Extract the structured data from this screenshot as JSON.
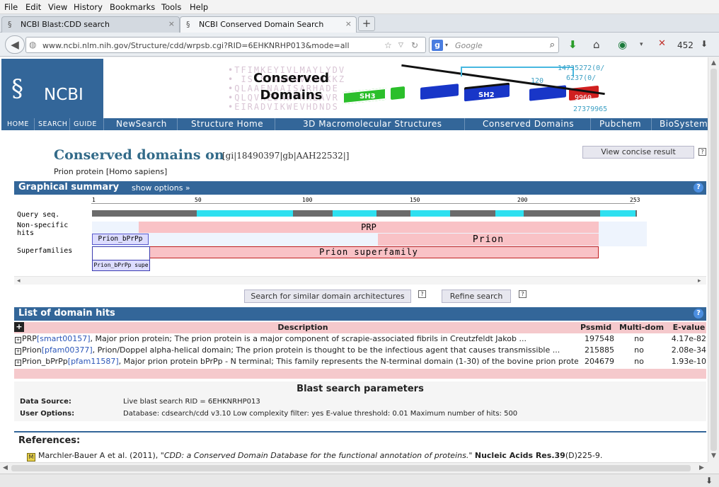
{
  "browser": {
    "menu": [
      "File",
      "Edit",
      "View",
      "History",
      "Bookmarks",
      "Tools",
      "Help"
    ],
    "tabs": [
      {
        "label": "NCBI Blast:CDD search",
        "close": "×"
      },
      {
        "label": "NCBI Conserved Domain Search",
        "close": "×"
      }
    ],
    "new_tab": "+",
    "url": "www.ncbi.nlm.nih.gov/Structure/cdd/wrpsb.cgi?RID=6EHKNRHP013&mode=all",
    "search_engine_letter": "g",
    "search_placeholder": "Google",
    "download_count": "452",
    "colors": {
      "accent": "#336699",
      "download_arrow": "#2a9d2a"
    }
  },
  "banner": {
    "logo": "NCBI",
    "title_line1": "Conserved",
    "title_line2": "Domains",
    "sequence_lines": [
      "•TFIMKEYIVLMAYLYDV",
      "• ISCSVVAHGVKAQKKZ",
      "•QLAAENAAISARHADE",
      "•QLQVKEDAWPAREAVR",
      "•EIRADVIKWEVHDNDS"
    ],
    "domain_labels": [
      "SH3",
      "SH2"
    ],
    "numbers": [
      "14735272(0/",
      "6237(0/",
      "120",
      "9960",
      "27379965"
    ],
    "nav_small": [
      "HOME",
      "SEARCH",
      "GUIDE"
    ],
    "nav_big": [
      "NewSearch",
      "Structure Home",
      "3D Macromolecular Structures",
      "Conserved Domains",
      "Pubchem",
      "BioSystems"
    ]
  },
  "header": {
    "title": "Conserved domains on",
    "id_text": "[gi|18490397|gb|AAH22532|]",
    "subtitle": "Prion protein [Homo sapiens]",
    "concise_button": "View concise result",
    "help": "?"
  },
  "graphical_summary": {
    "title": "Graphical summary",
    "show_options": "show options »",
    "help": "?",
    "row_labels": [
      "Query seq.",
      "Non-specific",
      "hits",
      "Superfamilies"
    ],
    "ticks": [
      "1",
      "50",
      "100",
      "150",
      "200",
      "253"
    ],
    "bars": {
      "prp": "PRP",
      "prion": "Prion",
      "prion_bprpp": "Prion_bPrPp",
      "prion_superfamily": "Prion superfamily",
      "prion_bprpp_super": "Prion_bPrPp supe"
    },
    "buttons": {
      "similar": "Search for similar domain architectures",
      "refine": "Refine search"
    }
  },
  "domain_hits": {
    "title": "List of domain hits",
    "help": "?",
    "expand": "+",
    "columns": [
      "Description",
      "Pssmid",
      "Multi-dom",
      "E-value"
    ],
    "rows": [
      {
        "name": "PRP",
        "accession": "[smart00157]",
        "desc": ", Major prion protein; The prion protein is a major component of scrapie-associated fibrils in Creutzfeldt Jakob ...",
        "pssmid": "197548",
        "multidom": "no",
        "evalue": "4.17e-82"
      },
      {
        "name": "Prion",
        "accession": "[pfam00377]",
        "desc": ", Prion/Doppel alpha-helical domain; The prion protein is thought to be the infectious agent that causes transmissible ...",
        "pssmid": "215885",
        "multidom": "no",
        "evalue": "2.08e-34"
      },
      {
        "name": "Prion_bPrPp",
        "accession": "[pfam11587]",
        "desc": ", Major prion protein bPrPp - N terminal; This family represents the N-terminal domain (1-30) of the bovine prion protein",
        "pssmid": "204679",
        "multidom": "no",
        "evalue": "1.93e-10"
      }
    ]
  },
  "blast_params": {
    "title": "Blast search parameters",
    "data_source_label": "Data Source:",
    "data_source_value": "Live blast search RID = 6EHKNRHP013",
    "user_options_label": "User Options:",
    "user_options_value": "Database: cdsearch/cdd v3.10   Low complexity filter: yes   E-value threshold: 0.01   Maximum number of hits: 500"
  },
  "references": {
    "title": "References:",
    "authors": "Marchler-Bauer A et al. (2011),",
    "article": "\"CDD: a Conserved Domain Database for the functional annotation of proteins.\"",
    "journal": "Nucleic Acids Res.39",
    "issue": "(D)225-9."
  }
}
